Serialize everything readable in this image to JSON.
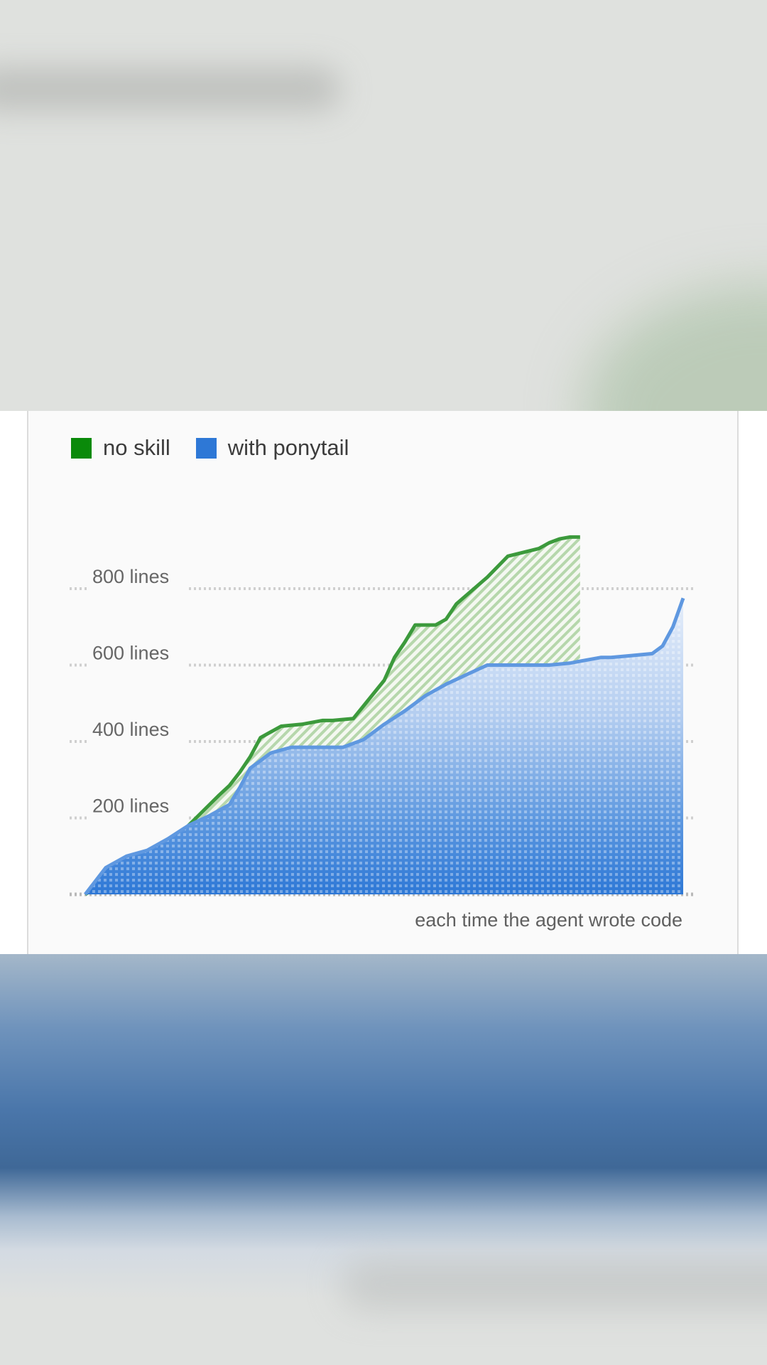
{
  "chart_data": {
    "type": "area",
    "xlabel": "each time the agent wrote code",
    "ylabel": "",
    "ylim": [
      0,
      930
    ],
    "yticks": [
      200,
      400,
      600,
      800
    ],
    "ytick_labels": [
      "200 lines",
      "400 lines",
      "600 lines",
      "800 lines"
    ],
    "grid": true,
    "legend": "top-left",
    "series": [
      {
        "name": "no skill",
        "color": "#1e8a1e",
        "x": [
          0,
          3,
          5,
          7,
          9,
          10,
          13,
          14,
          15,
          16,
          17,
          19,
          21,
          23,
          24,
          26,
          29,
          30,
          31,
          32,
          34,
          35,
          36,
          39,
          41,
          44,
          45,
          46,
          47,
          48
        ],
        "y": [
          0,
          50,
          80,
          105,
          130,
          180,
          260,
          285,
          320,
          360,
          410,
          440,
          445,
          455,
          455,
          460,
          560,
          620,
          660,
          705,
          705,
          720,
          760,
          830,
          885,
          905,
          920,
          930,
          935,
          935
        ]
      },
      {
        "name": "with ponytail",
        "color": "#2e78d6",
        "x": [
          0,
          2,
          4,
          6,
          8,
          10,
          12,
          14,
          15,
          16,
          18,
          20,
          22,
          25,
          27,
          29,
          31,
          33,
          35,
          37,
          39,
          41,
          43,
          45,
          47,
          48,
          49,
          50,
          51,
          53,
          55,
          56,
          57,
          58
        ],
        "y": [
          0,
          70,
          100,
          115,
          145,
          180,
          205,
          235,
          280,
          330,
          370,
          385,
          385,
          385,
          405,
          445,
          480,
          520,
          550,
          575,
          600,
          600,
          600,
          600,
          605,
          610,
          615,
          620,
          620,
          625,
          630,
          650,
          700,
          775
        ]
      }
    ]
  }
}
